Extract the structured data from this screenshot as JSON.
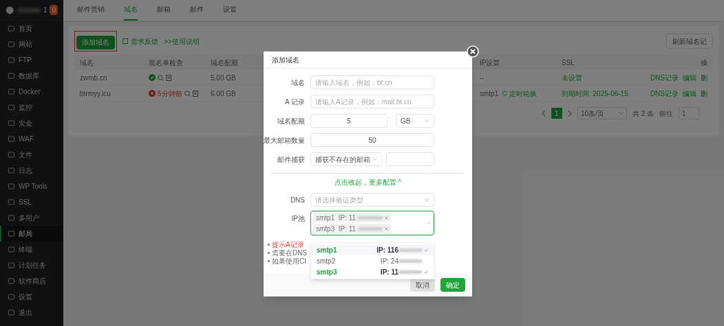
{
  "sidebar": {
    "account_suffix": "1",
    "badge": "0",
    "items": [
      {
        "label": "首页",
        "selected": false
      },
      {
        "label": "网站",
        "selected": false
      },
      {
        "label": "FTP",
        "selected": false
      },
      {
        "label": "数据库",
        "selected": false
      },
      {
        "label": "Docker",
        "selected": false
      },
      {
        "label": "监控",
        "selected": false
      },
      {
        "label": "安全",
        "selected": false
      },
      {
        "label": "WAF",
        "selected": false
      },
      {
        "label": "文件",
        "selected": false
      },
      {
        "label": "日志",
        "selected": false
      },
      {
        "label": "WP Tools",
        "selected": false
      },
      {
        "label": "SSL",
        "selected": false
      },
      {
        "label": "多用户",
        "selected": false
      },
      {
        "label": "邮局",
        "selected": true
      },
      {
        "label": "终端",
        "selected": false
      },
      {
        "label": "计划任务",
        "selected": false
      },
      {
        "label": "软件商店",
        "selected": false
      },
      {
        "label": "设置",
        "selected": false
      },
      {
        "label": "退出",
        "selected": false
      }
    ]
  },
  "tabs": [
    {
      "label": "邮件营销",
      "selected": false
    },
    {
      "label": "域名",
      "selected": true
    },
    {
      "label": "邮箱",
      "selected": false
    },
    {
      "label": "邮件",
      "selected": false
    },
    {
      "label": "设置",
      "selected": false
    }
  ],
  "toolbar": {
    "primary_button": "添加域名",
    "feedback_link": "需求反馈",
    "help_link": ">>使用说明",
    "refresh_button": "刷新域名记"
  },
  "table": {
    "columns": [
      "域名",
      "黑名单检查",
      "域名配额",
      "IP设置",
      "SSL",
      "操"
    ],
    "rows": [
      {
        "domain": "zwmb.cn",
        "check": {
          "passed": true
        },
        "quota": "5.00 GB",
        "ip_setting": "--",
        "ssl": "未设置",
        "actions": [
          "DNS记录",
          "编辑",
          "删"
        ]
      },
      {
        "domain": "btrmyy.icu",
        "check": {
          "passed": false,
          "text": "5分钟前"
        },
        "quota": "6.00 GB",
        "ip_setting": "smtp1",
        "rotation": "定时轮换",
        "ssl": "到期时间: 2025-06-15",
        "actions": [
          "DNS记录",
          "编辑",
          "删"
        ]
      }
    ]
  },
  "pagination": {
    "page": "1",
    "page_size": "10条/页",
    "total": "共 2 条",
    "goto_label": "前往",
    "goto_value": "1"
  },
  "modal": {
    "title": "添加域名",
    "fields": [
      {
        "kind": "text",
        "label": "域名",
        "placeholder": "请输入域名，例如：bt.cn"
      },
      {
        "kind": "text",
        "label": "A 记录",
        "placeholder": "请输入A记录，例如：mail.bt.cn"
      },
      {
        "kind": "number_unit",
        "label": "域名配额",
        "value": "5",
        "unit": "GB"
      },
      {
        "kind": "number",
        "label": "最大邮箱数量",
        "value": "50"
      },
      {
        "kind": "select_input",
        "label": "邮件捕获",
        "select": "捕获不存在的邮箱"
      }
    ],
    "toggle_link": "点击收起，更多配置 ^",
    "dns": {
      "label": "DNS",
      "placeholder": "请选择验证类型"
    },
    "ip_pool": {
      "label": "IP池",
      "tags": [
        "smtp1  IP: 11",
        "smtp3  IP: 11"
      ]
    },
    "notes": [
      {
        "text": "提示A记录",
        "kind": "warning"
      },
      {
        "text": "需要在DNS",
        "kind": "info"
      },
      {
        "text": "如果使用CI",
        "kind": "info"
      }
    ],
    "dropdown": [
      {
        "name": "smtp1",
        "ip": "IP: 116",
        "selected": true
      },
      {
        "name": "smtp2",
        "ip": "IP: 24",
        "selected": false
      },
      {
        "name": "smtp3",
        "ip": "IP: 11",
        "selected": true
      }
    ],
    "cancel": "取消",
    "confirm": "确定"
  }
}
